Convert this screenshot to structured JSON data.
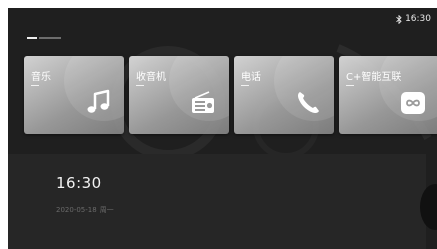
{
  "status_bar": {
    "icon": "bluetooth-icon",
    "time": "16:30"
  },
  "page_indicator": {
    "pages": 2,
    "active": 1
  },
  "cards": [
    {
      "label": "音乐",
      "icon": "music-note-icon"
    },
    {
      "label": "收音机",
      "icon": "radio-icon"
    },
    {
      "label": "电话",
      "icon": "phone-icon"
    },
    {
      "label": "C+智能互联",
      "icon": "infinity-link-icon"
    }
  ],
  "clock": {
    "time": "16:30",
    "date": "2020-05-18",
    "weekday": "周一"
  },
  "colors": {
    "background": "#1f1f1f",
    "panel": "#262626",
    "text_primary": "#f2f2f2",
    "text_secondary": "#6a6a6a"
  }
}
